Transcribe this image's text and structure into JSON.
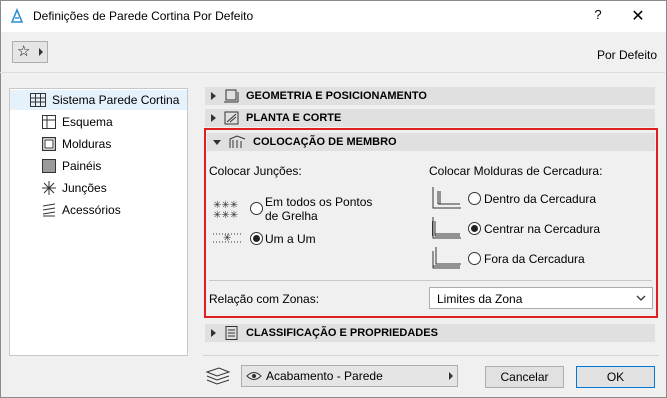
{
  "window": {
    "title": "Definições de Parede Cortina Por Defeito",
    "help_label": "?",
    "close_label": "✕"
  },
  "header": {
    "por_defeito": "Por Defeito"
  },
  "tree": {
    "root": "Sistema Parede Cortina",
    "children": [
      "Esquema",
      "Molduras",
      "Painéis",
      "Junções",
      "Acessórios"
    ]
  },
  "sections": {
    "geometria": "GEOMETRIA E POSICIONAMENTO",
    "planta": "PLANTA E CORTE",
    "colocacao": "COLOCAÇÃO DE MEMBRO",
    "classificacao": "CLASSIFICAÇÃO E PROPRIEDADES"
  },
  "colocacao": {
    "juncoes_label": "Colocar Junções:",
    "juncoes_options": [
      {
        "line1": "Em todos os Pontos",
        "line2": "de Grelha",
        "selected": false
      },
      {
        "line1": "Um a Um",
        "line2": "",
        "selected": true
      }
    ],
    "molduras_label": "Colocar Molduras de Cercadura:",
    "molduras_options": [
      {
        "label": "Dentro da Cercadura",
        "selected": false
      },
      {
        "label": "Centrar na Cercadura",
        "selected": true
      },
      {
        "label": "Fora da Cercadura",
        "selected": false
      }
    ],
    "zonas_label": "Relação com Zonas:",
    "zonas_value": "Limites da Zona"
  },
  "footer": {
    "layer_value": "Acabamento - Parede",
    "cancel_label": "Cancelar",
    "ok_label": "OK"
  },
  "colors": {
    "highlight_border": "#e02020",
    "selection_bg": "#e5f1fb",
    "ok_border": "#0078d7"
  }
}
